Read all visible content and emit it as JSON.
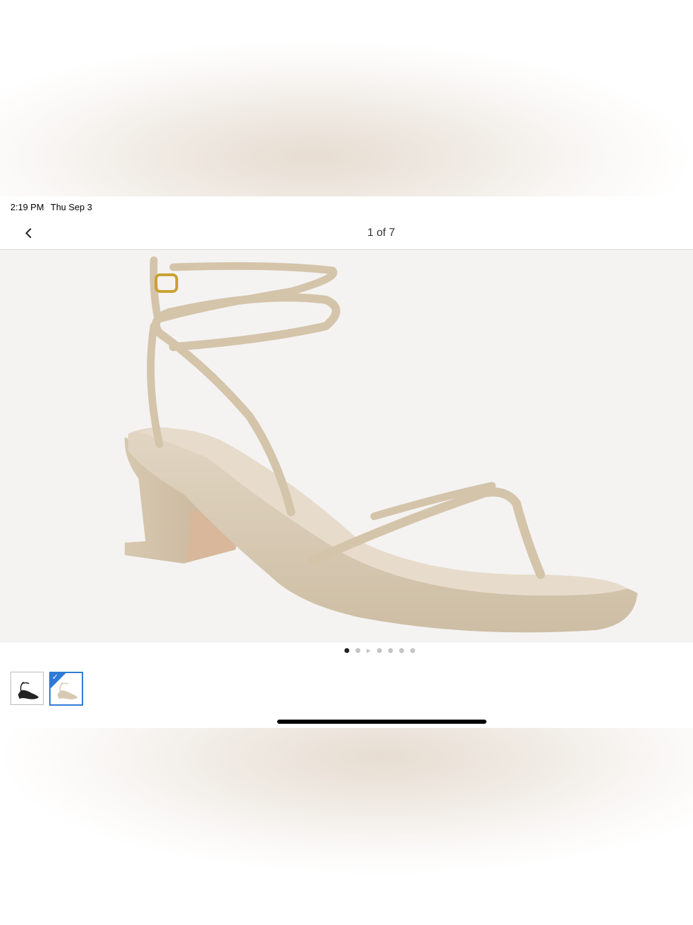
{
  "status_bar": {
    "time": "2:19 PM",
    "date": "Thu Sep 3"
  },
  "nav": {
    "back_icon": "chevron-left-icon",
    "page_counter": "1 of 7"
  },
  "pager": {
    "total": 7,
    "active_index": 0
  },
  "thumbnails": [
    {
      "name": "thumbnail-black-sandal",
      "selected": false
    },
    {
      "name": "thumbnail-beige-sandal",
      "selected": true
    }
  ],
  "colors": {
    "accent": "#2e7bd7",
    "sandal": "#d8c9b2"
  }
}
